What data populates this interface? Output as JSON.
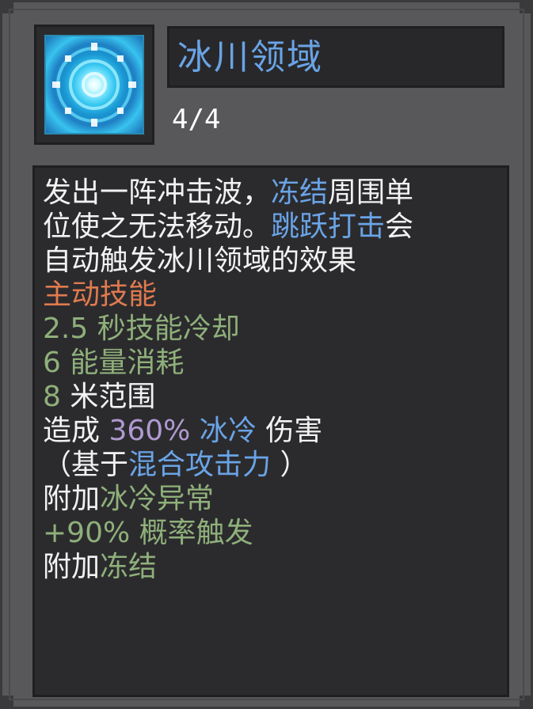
{
  "skill": {
    "title": "冰川领域",
    "level": "4/4",
    "icon": "ice-burst-icon"
  },
  "description": {
    "l1a": "发出一阵冲击波，",
    "l1b": "冻结",
    "l1c": "周围单",
    "l2a": "位使之无法移动。",
    "l2b": "跳跃打击",
    "l2c": "会",
    "l3": "自动触发冰川领域的效果"
  },
  "stats": {
    "type": "主动技能",
    "cooldown": "2.5 秒技能冷却",
    "energy": "6 能量消耗",
    "range": "8 米范围",
    "dmg_prefix": "造成 ",
    "dmg_value": "360%",
    "dmg_element": " 冰冷",
    "dmg_suffix": " 伤害",
    "based_open": "（基于",
    "based_stat": "混合攻击力",
    "based_close": " ）",
    "add1_prefix": "附加",
    "add1_effect": "冰冷异常",
    "chance": "+90% 概率触发",
    "add2_prefix": "附加",
    "add2_effect": "冻结"
  },
  "colors": {
    "keyword_blue": "#6aa4e6",
    "skill_type_orange": "#e07a4e",
    "stat_green": "#8fb07a",
    "damage_purple": "#b09ad0"
  }
}
